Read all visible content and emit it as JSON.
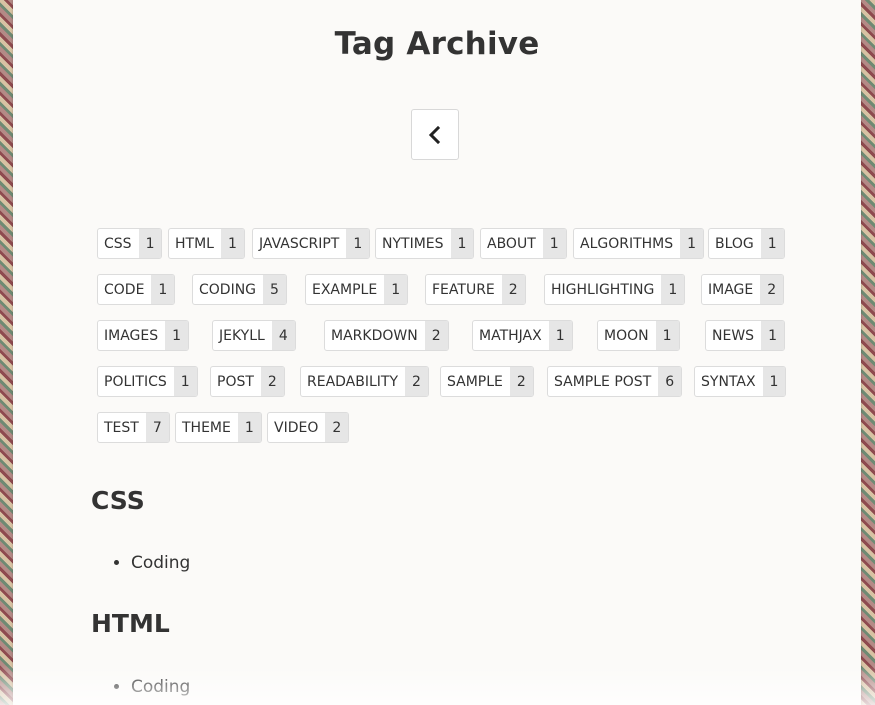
{
  "page": {
    "title": "Tag Archive"
  },
  "nav": {
    "back_icon": "chevron-left-icon"
  },
  "tags": [
    {
      "name": "CSS",
      "count": "1"
    },
    {
      "name": "HTML",
      "count": "1"
    },
    {
      "name": "JAVASCRIPT",
      "count": "1"
    },
    {
      "name": "NYTIMES",
      "count": "1"
    },
    {
      "name": "ABOUT",
      "count": "1"
    },
    {
      "name": "ALGORITHMS",
      "count": "1"
    },
    {
      "name": "BLOG",
      "count": "1"
    },
    {
      "name": "CODE",
      "count": "1"
    },
    {
      "name": "CODING",
      "count": "5"
    },
    {
      "name": "EXAMPLE",
      "count": "1"
    },
    {
      "name": "FEATURE",
      "count": "2"
    },
    {
      "name": "HIGHLIGHTING",
      "count": "1"
    },
    {
      "name": "IMAGE",
      "count": "2"
    },
    {
      "name": "IMAGES",
      "count": "1"
    },
    {
      "name": "JEKYLL",
      "count": "4"
    },
    {
      "name": "MARKDOWN",
      "count": "2"
    },
    {
      "name": "MATHJAX",
      "count": "1"
    },
    {
      "name": "MOON",
      "count": "1"
    },
    {
      "name": "NEWS",
      "count": "1"
    },
    {
      "name": "POLITICS",
      "count": "1"
    },
    {
      "name": "POST",
      "count": "2"
    },
    {
      "name": "READABILITY",
      "count": "2"
    },
    {
      "name": "SAMPLE",
      "count": "2"
    },
    {
      "name": "SAMPLE POST",
      "count": "6"
    },
    {
      "name": "SYNTAX",
      "count": "1"
    },
    {
      "name": "TEST",
      "count": "7"
    },
    {
      "name": "THEME",
      "count": "1"
    },
    {
      "name": "VIDEO",
      "count": "2"
    }
  ],
  "sections": [
    {
      "heading": "CSS",
      "posts": [
        "Coding"
      ]
    },
    {
      "heading": "HTML",
      "posts": [
        "Coding"
      ]
    }
  ]
}
